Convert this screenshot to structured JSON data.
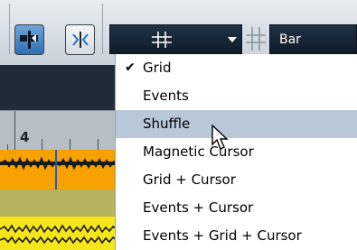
{
  "toolbar": {
    "snap_button_icon": "snap-to-grid-icon",
    "snap_button_active": true,
    "snap_type_icon": "magnetic-split-icon",
    "grid_type_icon": "grid-icon",
    "quantize_icon": "grid-icon",
    "quantize_value": "Bar"
  },
  "ruler": {
    "bar_number": "4"
  },
  "menu": {
    "items": [
      {
        "label": "Grid",
        "checked": true
      },
      {
        "label": "Events",
        "checked": false
      },
      {
        "label": "Shuffle",
        "checked": false,
        "hovered": true
      },
      {
        "label": "Magnetic Cursor",
        "checked": false
      },
      {
        "label": "Grid + Cursor",
        "checked": false
      },
      {
        "label": "Events + Cursor",
        "checked": false
      },
      {
        "label": "Events + Grid + Cursor",
        "checked": false
      }
    ],
    "check_glyph": "✔"
  },
  "colors": {
    "active_button": "#2f6fb5",
    "selector_bg": "#13202e",
    "hover_bg": "#b8c8d8",
    "audio_event_orange": "#f6a100",
    "audio_event_yellow": "#f4e61a",
    "cursor_blue": "#1e5fc4"
  },
  "pointer_icon": "mouse-pointer-icon"
}
